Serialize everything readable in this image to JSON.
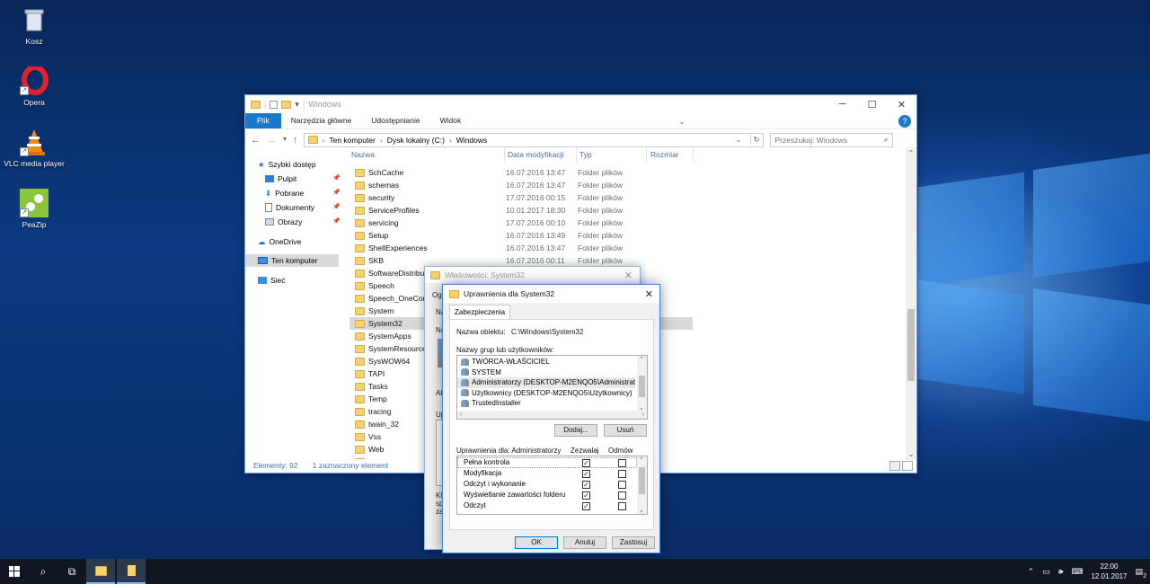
{
  "desktop": {
    "icons": [
      {
        "label": "Kosz"
      },
      {
        "label": "Opera"
      },
      {
        "label": "VLC media player"
      },
      {
        "label": "PeaZip"
      }
    ]
  },
  "explorer": {
    "title": "Windows",
    "ribbon": {
      "file": "Plik",
      "tabs": [
        "Narzędzia główne",
        "Udostępnianie",
        "Widok"
      ],
      "help": "?"
    },
    "address": {
      "parts": [
        "Ten komputer",
        "Dysk lokalny (C:)",
        "Windows"
      ]
    },
    "search": {
      "placeholder": "Przeszukaj: Windows"
    },
    "nav": {
      "quick_access": "Szybki dostęp",
      "items": [
        "Pulpit",
        "Pobrane",
        "Dokumenty",
        "Obrazy"
      ],
      "onedrive": "OneDrive",
      "this_pc": "Ten komputer",
      "network": "Sieć"
    },
    "columns": {
      "name": "Nazwa",
      "date": "Data modyfikacji",
      "type": "Typ",
      "size": "Rozmiar"
    },
    "files": [
      {
        "name": "SchCache",
        "date": "16.07.2016 13:47",
        "type": "Folder plików"
      },
      {
        "name": "schemas",
        "date": "16.07.2016 13:47",
        "type": "Folder plików"
      },
      {
        "name": "security",
        "date": "17.07.2016 00:15",
        "type": "Folder plików"
      },
      {
        "name": "ServiceProfiles",
        "date": "10.01.2017 18:30",
        "type": "Folder plików"
      },
      {
        "name": "servicing",
        "date": "17.07.2016 00:10",
        "type": "Folder plików"
      },
      {
        "name": "Setup",
        "date": "16.07.2016 13:49",
        "type": "Folder plików"
      },
      {
        "name": "ShellExperiences",
        "date": "16.07.2016 13:47",
        "type": "Folder plików"
      },
      {
        "name": "SKB",
        "date": "16.07.2016 00:11",
        "type": "Folder plików"
      },
      {
        "name": "SoftwareDistribution",
        "date": "",
        "type": ""
      },
      {
        "name": "Speech",
        "date": "",
        "type": ""
      },
      {
        "name": "Speech_OneCore",
        "date": "",
        "type": ""
      },
      {
        "name": "System",
        "date": "",
        "type": ""
      },
      {
        "name": "System32",
        "date": "",
        "type": ""
      },
      {
        "name": "SystemApps",
        "date": "",
        "type": ""
      },
      {
        "name": "SystemResources",
        "date": "",
        "type": ""
      },
      {
        "name": "SysWOW64",
        "date": "",
        "type": ""
      },
      {
        "name": "TAPI",
        "date": "",
        "type": ""
      },
      {
        "name": "Tasks",
        "date": "",
        "type": ""
      },
      {
        "name": "Temp",
        "date": "",
        "type": ""
      },
      {
        "name": "tracing",
        "date": "",
        "type": ""
      },
      {
        "name": "twain_32",
        "date": "",
        "type": ""
      },
      {
        "name": "Vss",
        "date": "",
        "type": ""
      },
      {
        "name": "Web",
        "date": "",
        "type": ""
      },
      {
        "name": "WinSxS",
        "date": "",
        "type": ""
      }
    ],
    "status": {
      "count": "Elementy: 92",
      "selected": "1 zaznaczony element"
    }
  },
  "props": {
    "title": "Właściwości: System32",
    "stubs": [
      "Ogó",
      "Na",
      "Na",
      "Ab",
      "Up",
      "Kli",
      "spe",
      "zaa"
    ]
  },
  "perm": {
    "title": "Uprawnienia dla System32",
    "tab": "Zabezpieczenia",
    "object_label": "Nazwa obiektu:",
    "object_value": "C:\\Windows\\System32",
    "groups_label": "Nazwy grup lub użytkowników:",
    "users": [
      "TWÓRCA-WŁAŚCICIEL",
      "SYSTEM",
      "Administratorzy (DESKTOP-M2ENQO5\\Administratorzy)",
      "Użytkownicy (DESKTOP-M2ENQO5\\Użytkownicy)",
      "TrustedInstaller"
    ],
    "add_button": "Dodaj...",
    "remove_button": "Usuń",
    "perm_label": "Uprawnienia dla: Administratorzy",
    "allow_header": "Zezwalaj",
    "deny_header": "Odmów",
    "permissions": [
      {
        "name": "Pełna kontrola",
        "allow": true,
        "deny": false
      },
      {
        "name": "Modyfikacja",
        "allow": true,
        "deny": false
      },
      {
        "name": "Odczyt i wykonanie",
        "allow": true,
        "deny": false
      },
      {
        "name": "Wyświetlanie zawartości folderu",
        "allow": true,
        "deny": false
      },
      {
        "name": "Odczyt",
        "allow": true,
        "deny": false
      }
    ],
    "ok_button": "OK",
    "cancel_button": "Anuluj",
    "apply_button": "Zastosuj"
  },
  "taskbar": {
    "time": "22:00",
    "date": "12.01.2017",
    "notifications": "2"
  }
}
